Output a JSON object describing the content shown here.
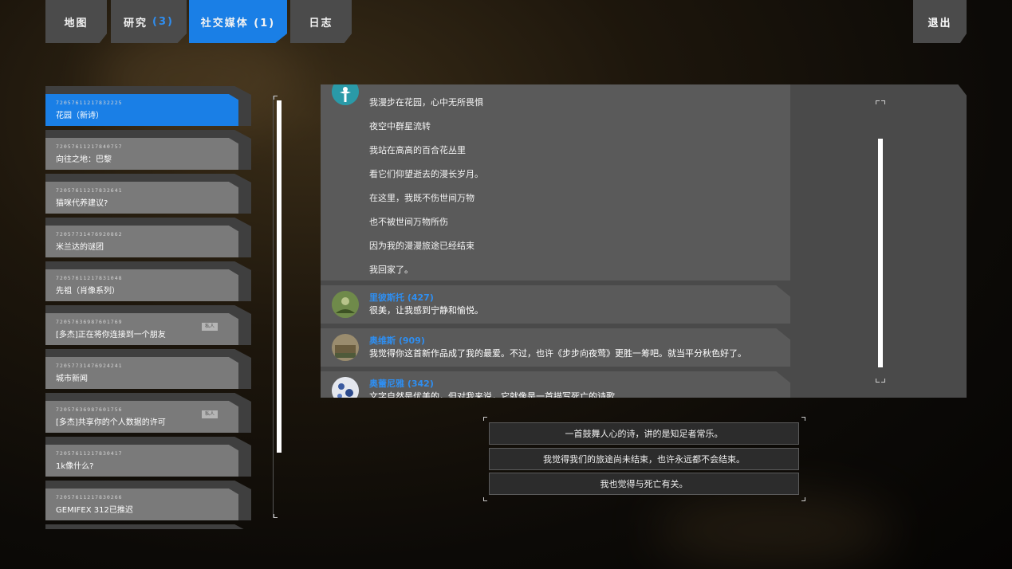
{
  "tabs": [
    {
      "label": "地图",
      "count": ""
    },
    {
      "label": "研究",
      "count": "(3)"
    },
    {
      "label": "社交媒体 (1)",
      "count": ""
    },
    {
      "label": "日志",
      "count": ""
    }
  ],
  "exit_label": "退出",
  "posts": [
    {
      "id": "72057611217832225",
      "title": "花园（新诗）",
      "active": true,
      "badge": ""
    },
    {
      "id": "72057611217840757",
      "title": "向往之地：巴黎",
      "badge": ""
    },
    {
      "id": "72057611217832641",
      "title": "猫咪代养建议?",
      "badge": ""
    },
    {
      "id": "72057731476920862",
      "title": "米兰达的谜团",
      "badge": ""
    },
    {
      "id": "72057611217831048",
      "title": "先祖（肖像系列）",
      "badge": ""
    },
    {
      "id": "72057636987601769",
      "title": "[多杰]正在将你连接到一个朋友",
      "badge": "私人"
    },
    {
      "id": "72057731476924241",
      "title": "城市新闻",
      "badge": ""
    },
    {
      "id": "72057636987601756",
      "title": "[多杰]共享你的个人数据的许可",
      "badge": "私人"
    },
    {
      "id": "72057611217830417",
      "title": "1k像什么?",
      "badge": ""
    },
    {
      "id": "72057611217830266",
      "title": "GEMIFEX 312已推迟",
      "badge": ""
    }
  ],
  "poem": [
    "我漫步在花园，心中无所畏惧",
    "夜空中群星流转",
    "我站在高高的百合花丛里",
    "看它们仰望逝去的漫长岁月。",
    "在这里，我既不伤世间万物",
    "也不被世间万物所伤",
    "因为我的漫漫旅途已经结束",
    "我回家了。"
  ],
  "comments": [
    {
      "name": "里彼斯托 (427)",
      "text": "很美，让我感到宁静和愉悦。"
    },
    {
      "name": "奥维斯 (909)",
      "text": "我觉得你这首新作品成了我的最爱。不过，也许《步步向夜莺》更胜一筹吧。就当平分秋色好了。"
    },
    {
      "name": "奥蕾尼雅 (342)",
      "text": "文字自然是优美的，但对我来说，它就像是一首描写死亡的诗歌"
    }
  ],
  "replies": [
    "一首鼓舞人心的诗，讲的是知足者常乐。",
    "我觉得我们的旅途尚未结束，也许永远都不会结束。",
    "我也觉得与死亡有关。"
  ],
  "colors": {
    "accent": "#1a7fe6",
    "name": "#2f8ef0"
  }
}
